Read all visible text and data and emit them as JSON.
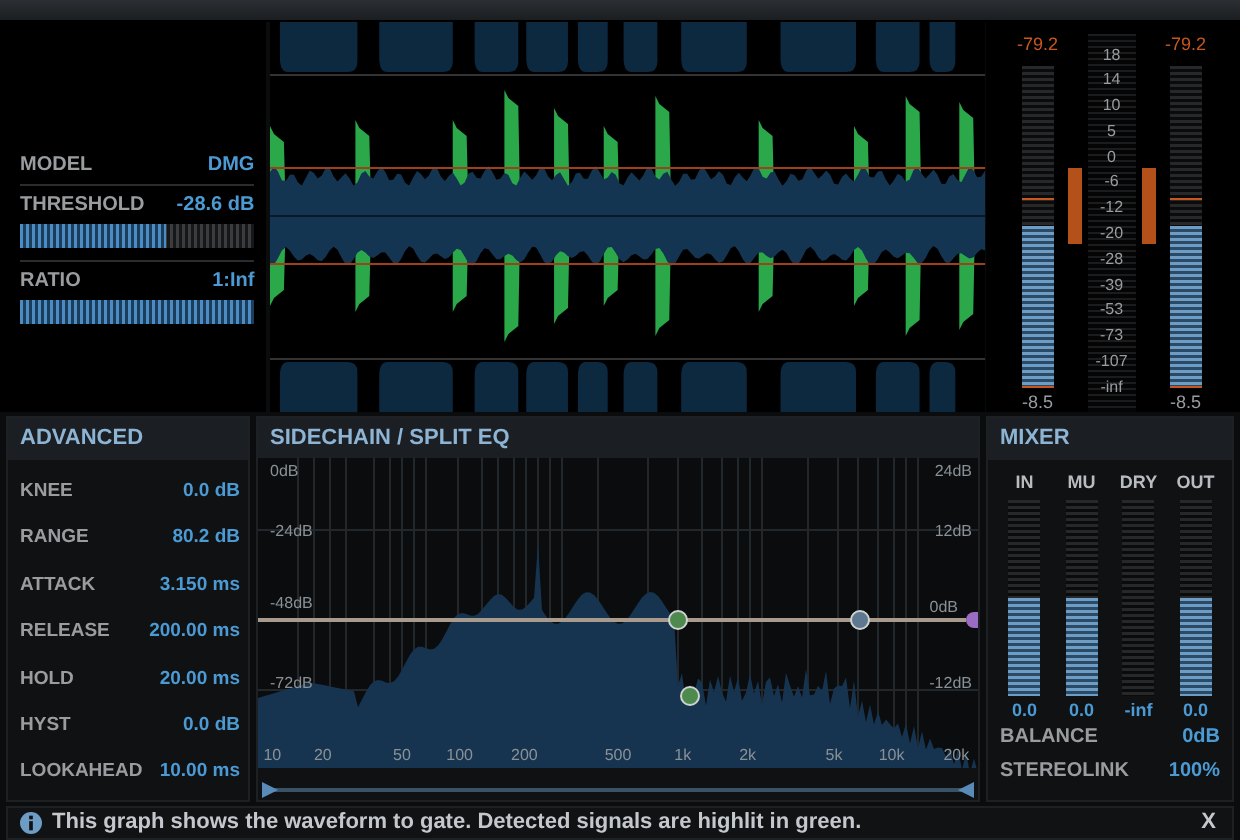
{
  "left_panel": {
    "model": {
      "label": "MODEL",
      "value": "DMG"
    },
    "threshold": {
      "label": "THRESHOLD",
      "value": "-28.6 dB",
      "level": 0.62
    },
    "ratio": {
      "label": "RATIO",
      "value": "1:Inf",
      "level": 1
    }
  },
  "output_meters": {
    "scale": [
      "18",
      "14",
      "10",
      "5",
      "0",
      "-6",
      "-12",
      "-20",
      "-28",
      "-39",
      "-53",
      "-73",
      "-107",
      "-inf"
    ],
    "channels": [
      {
        "peak": "-79.2",
        "reading": "-8.5",
        "level": 0.5
      },
      {
        "peak": "-79.2",
        "reading": "-8.5",
        "level": 0.5
      }
    ]
  },
  "advanced": {
    "title": "ADVANCED",
    "params": [
      {
        "label": "KNEE",
        "value": "0.0 dB"
      },
      {
        "label": "RANGE",
        "value": "80.2 dB"
      },
      {
        "label": "ATTACK",
        "value": "3.150 ms"
      },
      {
        "label": "RELEASE",
        "value": "200.00 ms"
      },
      {
        "label": "HOLD",
        "value": "20.00 ms"
      },
      {
        "label": "HYST",
        "value": "0.0 dB"
      },
      {
        "label": "LOOKAHEAD",
        "value": "10.00 ms"
      }
    ]
  },
  "sidechain": {
    "title": "SIDECHAIN / SPLIT EQ",
    "left_axis": [
      "0dB",
      "-24dB",
      "-48dB",
      "-72dB"
    ],
    "right_axis": [
      "24dB",
      "12dB",
      "0dB",
      "-12dB"
    ],
    "freq_axis": [
      "10",
      "20",
      "50",
      "100",
      "200",
      "500",
      "1k",
      "2k",
      "5k",
      "10k",
      "20k"
    ]
  },
  "mixer": {
    "title": "MIXER",
    "meters": [
      {
        "label": "IN",
        "value": "0.0",
        "level": 0.5
      },
      {
        "label": "MU",
        "value": "0.0",
        "level": 0.5
      },
      {
        "label": "DRY",
        "value": "-inf",
        "level": 0
      },
      {
        "label": "OUT",
        "value": "0.0",
        "level": 0.5
      }
    ],
    "balance": {
      "label": "BALANCE",
      "value": "0dB"
    },
    "stereolink": {
      "label": "STEREOLINK",
      "value": "100%"
    }
  },
  "info_bar": {
    "text": "This graph shows the waveform to gate. Detected signals are highlit in green.",
    "close": "X"
  }
}
